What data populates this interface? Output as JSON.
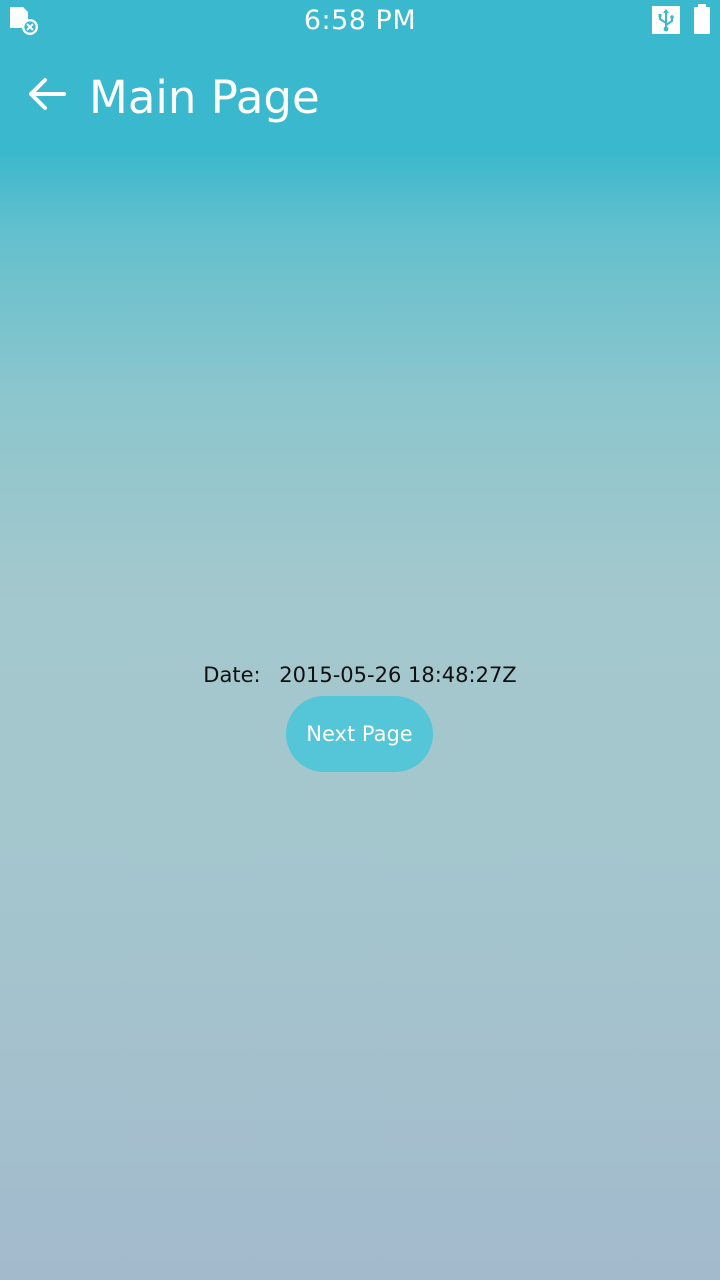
{
  "status_bar": {
    "time": "6:58 PM",
    "left_icon": "screenshot-error-icon",
    "usb_icon": "usb-icon",
    "battery_icon": "battery-icon"
  },
  "header": {
    "back_icon": "back-arrow-icon",
    "title": "Main Page"
  },
  "main": {
    "date_label": "Date:",
    "date_value": "2015-05-26 18:48:27Z",
    "next_button_label": "Next Page"
  },
  "colors": {
    "header_background": "#3ab8cd",
    "gradient_bottom": "#a3bacd",
    "button_background": "#55c5d8",
    "text_light": "#ffffff",
    "text_dark": "#101010"
  }
}
